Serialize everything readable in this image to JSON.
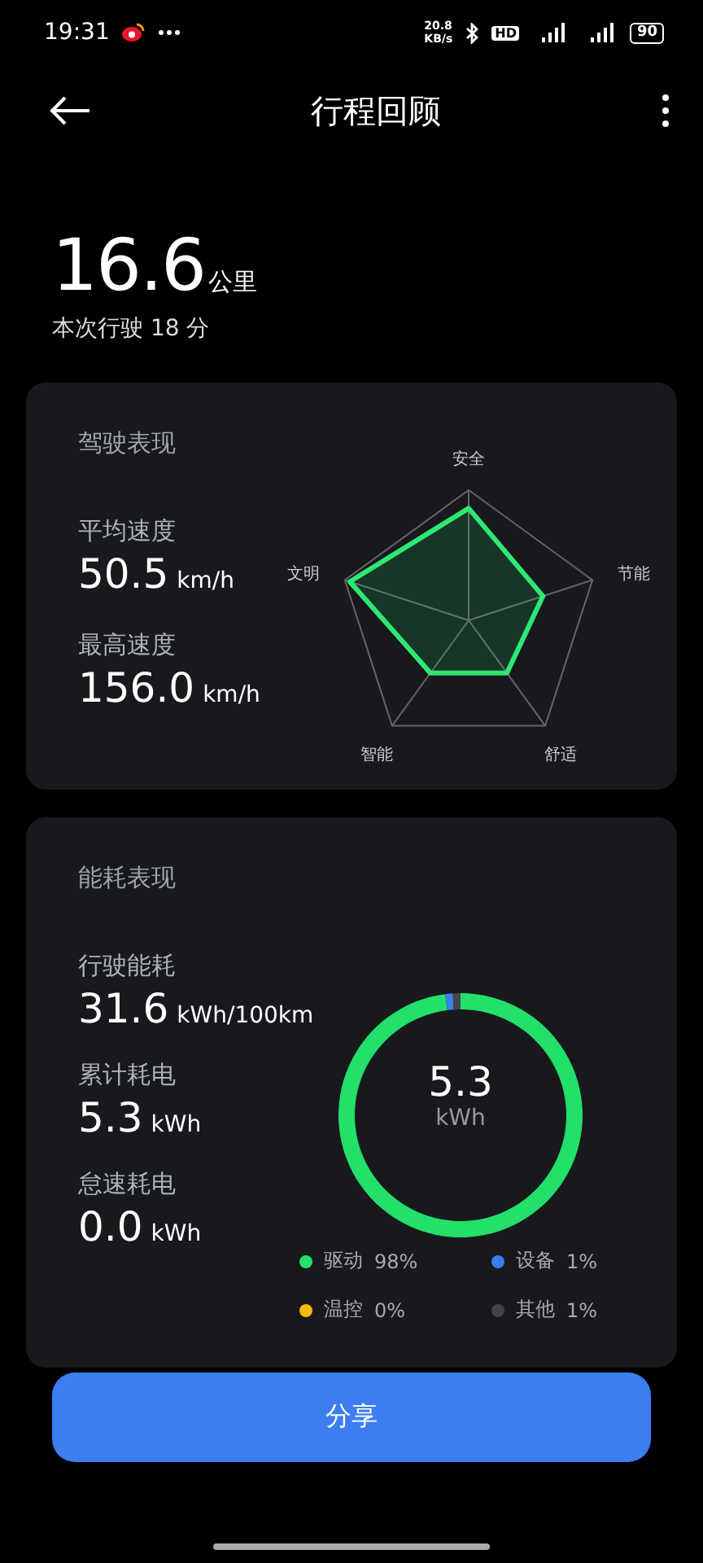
{
  "status_bar": {
    "time": "19:31",
    "net_speed": [
      "20.8",
      "KB/s"
    ],
    "hd": "HD",
    "battery": "90"
  },
  "header": {
    "title": "行程回顾"
  },
  "trip": {
    "distance": "16.6",
    "unit": "公里",
    "duration": "本次行驶 18 分"
  },
  "driving": {
    "title": "驾驶表现",
    "stats": [
      {
        "label": "平均速度",
        "value": "50.5",
        "unit": "km/h"
      },
      {
        "label": "最高速度",
        "value": "156.0",
        "unit": "km/h"
      }
    ],
    "radar_axes": [
      "安全",
      "节能",
      "舒适",
      "智能",
      "文明"
    ]
  },
  "energy": {
    "title": "能耗表现",
    "stats": [
      {
        "label": "行驶能耗",
        "value": "31.6",
        "unit": "kWh/100km"
      },
      {
        "label": "累计耗电",
        "value": "5.3",
        "unit": "kWh"
      },
      {
        "label": "怠速耗电",
        "value": "0.0",
        "unit": "kWh"
      }
    ],
    "center_value": "5.3",
    "center_unit": "kWh",
    "legend": [
      {
        "percent": "98%",
        "color": "#22e06a"
      },
      {
        "percent": "1%",
        "color": "#3a7ef0"
      },
      {
        "percent": "0%",
        "color": "#f5b915"
      },
      {
        "percent": "1%",
        "color": "#444444"
      }
    ],
    "chart_data": {
      "type": "donut",
      "categories": [
        "驱动",
        "设备",
        "温控",
        "其他"
      ],
      "values": [
        98,
        1,
        0,
        1
      ]
    }
  },
  "share_button": "分享"
}
